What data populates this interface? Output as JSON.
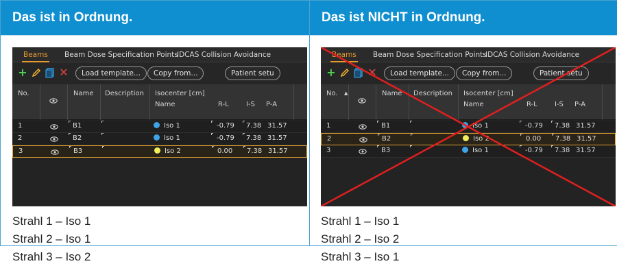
{
  "columns": [
    {
      "title": "Das ist in Ordnung.",
      "crossed": false,
      "tabs": [
        "Beams",
        "Beam Dose Specification Points",
        "IDCAS Collision Avoidance"
      ],
      "toolbar": {
        "load_template": "Load template...",
        "copy_from": "Copy from...",
        "patient_setup": "Patient setu"
      },
      "headers": {
        "no": "No.",
        "name": "Name",
        "description": "Description",
        "isocenter": "Isocenter [cm]",
        "iso_name": "Name",
        "rl": "R-L",
        "is": "I-S",
        "pa": "P-A"
      },
      "rows": [
        {
          "no": "1",
          "name": "B1",
          "iso": "Iso 1",
          "iso_color": "#3fa3e8",
          "rl": "-0.79",
          "is": "7.38",
          "pa": "31.57",
          "selected": false
        },
        {
          "no": "2",
          "name": "B2",
          "iso": "Iso 1",
          "iso_color": "#3fa3e8",
          "rl": "-0.79",
          "is": "7.38",
          "pa": "31.57",
          "selected": false
        },
        {
          "no": "3",
          "name": "B3",
          "iso": "Iso 2",
          "iso_color": "#f2ee5a",
          "rl": "0.00",
          "is": "7.38",
          "pa": "31.57",
          "selected": true
        }
      ],
      "notes": [
        "Strahl 1 – Iso 1",
        "Strahl 2 – Iso 1",
        "Strahl 3 – Iso 2"
      ]
    },
    {
      "title": "Das ist NICHT in Ordnung.",
      "crossed": true,
      "tabs": [
        "Beams",
        "Beam Dose Specification Points",
        "IDCAS Collision Avoidance"
      ],
      "toolbar": {
        "load_template": "Load template...",
        "copy_from": "Copy from...",
        "patient_setup": "Patient setu"
      },
      "headers": {
        "no": "No.",
        "name": "Name",
        "description": "Description",
        "isocenter": "Isocenter [cm]",
        "iso_name": "Name",
        "rl": "R-L",
        "is": "I-S",
        "pa": "P-A"
      },
      "rows": [
        {
          "no": "1",
          "name": "B1",
          "iso": "Iso 1",
          "iso_color": "#3fa3e8",
          "rl": "-0.79",
          "is": "7.38",
          "pa": "31.57",
          "selected": false
        },
        {
          "no": "2",
          "name": "B2",
          "iso": "Iso 2",
          "iso_color": "#f2ee5a",
          "rl": "0.00",
          "is": "7.38",
          "pa": "31.57",
          "selected": true
        },
        {
          "no": "3",
          "name": "B3",
          "iso": "Iso 1",
          "iso_color": "#3fa3e8",
          "rl": "-0.79",
          "is": "7.38",
          "pa": "31.57",
          "selected": false
        }
      ],
      "notes": [
        "Strahl 1 – Iso 1",
        "Strahl 2 – Iso 2",
        "Strahl 3 – Iso 1"
      ]
    }
  ],
  "colors": {
    "header_blue": "#0f8fd0",
    "accent_orange": "#e59a2f",
    "cross_red": "#e0201f"
  }
}
